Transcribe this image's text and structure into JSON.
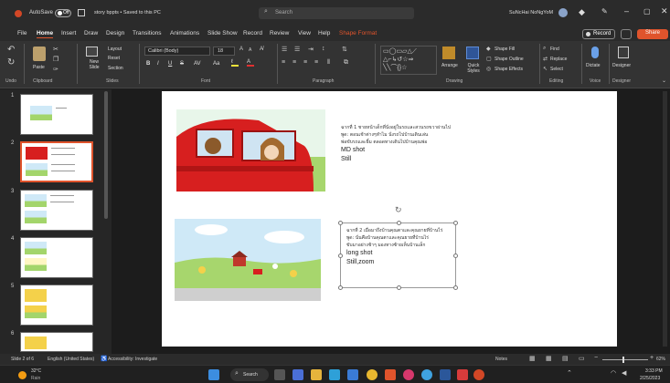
{
  "titlebar": {
    "autosave_label": "AutoSave",
    "autosave_state": "Off",
    "doc_title": "story bppts • Saved to this PC",
    "search_placeholder": "Search",
    "user_name": "SuNcHai NoNgYoM"
  },
  "menu": {
    "tabs": [
      "File",
      "Home",
      "Insert",
      "Draw",
      "Design",
      "Transitions",
      "Animations",
      "Slide Show",
      "Record",
      "Review",
      "View",
      "Help",
      "Shape Format"
    ],
    "active": "Home",
    "record_label": "Record",
    "share_label": "Share"
  },
  "ribbon": {
    "groups": [
      "Undo",
      "Clipboard",
      "Slides",
      "Font",
      "Paragraph",
      "Drawing",
      "Editing",
      "Voice",
      "Designer"
    ],
    "paste": "Paste",
    "new_slide": "New Slide",
    "layout": "Layout",
    "reset": "Reset",
    "section": "Section",
    "font_name": "Calibri (Body)",
    "font_size": "18",
    "arrange": "Arrange",
    "quick_styles": "Quick Styles",
    "shape_fill": "Shape Fill",
    "shape_outline": "Shape Outline",
    "shape_effects": "Shape Effects",
    "find": "Find",
    "replace": "Replace",
    "select": "Select",
    "dictate": "Dictate",
    "designer": "Designer"
  },
  "thumbnails": [
    {
      "num": "1"
    },
    {
      "num": "2"
    },
    {
      "num": "3"
    },
    {
      "num": "4"
    },
    {
      "num": "5"
    },
    {
      "num": "6"
    }
  ],
  "slide": {
    "text1_line1": "ฉากที่ 1 ชายหน้าเด็กที่นั่งอยู่ในรถและสวนรถขวาผ่านไป",
    "text1_line2": "พูด: ตอนเช้าต่างๆทำไม นั่งรถไปบ้านเดินเล่น",
    "text1_line3": "พ่อขับรถและยิ้ม ตลอดทางเดินไปบ้านคุณพ่อ",
    "text1_shot": "MD shot",
    "text1_mode": "Still",
    "text2_line1": "ฉากที่ 2 เมื่อมาถึงบ้านคุณตาและคุณยายที่บ้านไร่",
    "text2_line2": "พูด: นั่นคือบ้านคุณตาและคุณยายที่บ้านไร่",
    "text2_line3": "ขับมาอย่างช้าๆ มองทางซ้ายเห็นบ้านเล็ก",
    "text2_shot": "long shot",
    "text2_mode": "Still,zoom"
  },
  "status": {
    "slide_info": "Slide 2 of 6",
    "language": "English (United States)",
    "accessibility": "Accessibility: Investigate",
    "notes": "Notes",
    "zoom": "62%"
  },
  "taskbar": {
    "weather_temp": "32°C",
    "weather_desc": "Rain",
    "search_label": "Search",
    "time": "3:33 PM",
    "date": "2/25/2023"
  },
  "colors": {
    "accent": "#e0542c",
    "car_red": "#d71f1f"
  }
}
